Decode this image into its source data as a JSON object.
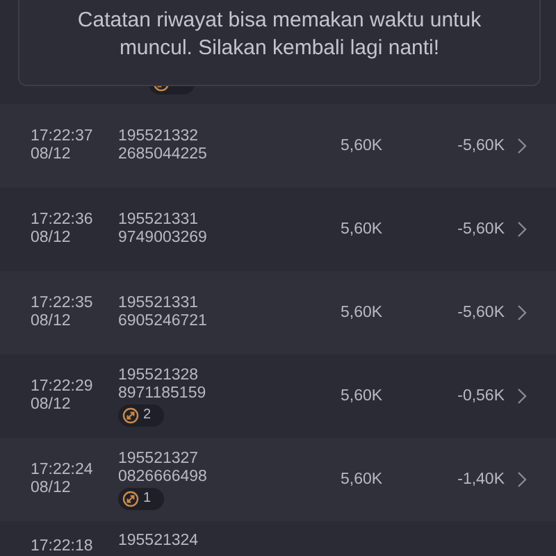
{
  "toast": {
    "message": "Catatan riwayat bisa memakan waktu untuk muncul. Silakan kembali lagi nanti!"
  },
  "rows": [
    {
      "kind": "partial",
      "badge": {}
    },
    {
      "time": "17:22:37",
      "date": "08/12",
      "id_line_1": "195521332",
      "id_line_2": "2685044225",
      "amount": "5,60K",
      "change": "-5,60K"
    },
    {
      "time": "17:22:36",
      "date": "08/12",
      "id_line_1": "195521331",
      "id_line_2": "9749003269",
      "amount": "5,60K",
      "change": "-5,60K"
    },
    {
      "time": "17:22:35",
      "date": "08/12",
      "id_line_1": "195521331",
      "id_line_2": "6905246721",
      "amount": "5,60K",
      "change": "-5,60K"
    },
    {
      "time": "17:22:29",
      "date": "08/12",
      "id_line_1": "195521328",
      "id_line_2": "8971185159",
      "badge": {
        "count": "2"
      },
      "amount": "5,60K",
      "change": "-0,56K"
    },
    {
      "time": "17:22:24",
      "date": "08/12",
      "id_line_1": "195521327",
      "id_line_2": "0826666498",
      "badge": {
        "count": "1"
      },
      "amount": "5,60K",
      "change": "-1,40K"
    },
    {
      "kind": "cut",
      "time": "17:22:18",
      "id_line_1": "195521324"
    }
  ]
}
